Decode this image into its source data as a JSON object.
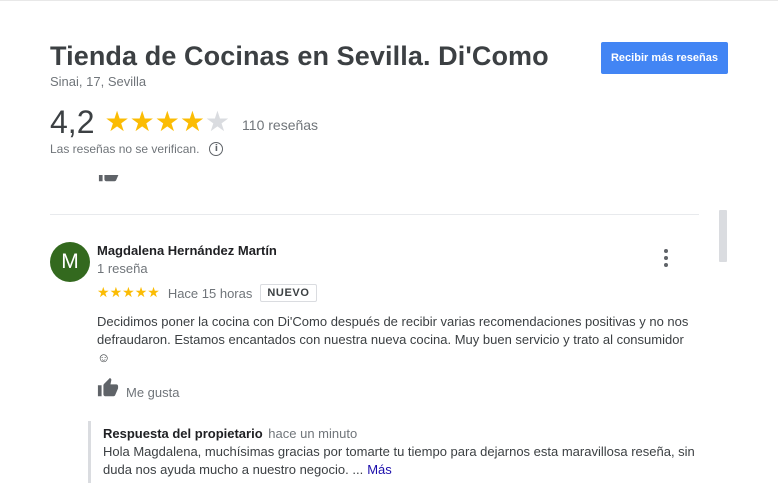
{
  "business": {
    "title": "Tienda de Cocinas en Sevilla. Di'Como",
    "address": "Sinai, 17, Sevilla"
  },
  "actions": {
    "more_reviews_label": "Recibir más reseñas"
  },
  "rating": {
    "value": "4,2",
    "stars_filled": 4,
    "stars_total": 5,
    "count_label": "110 reseñas",
    "disclaimer": "Las reseñas no se verifican.",
    "info_glyph": "i"
  },
  "review": {
    "avatar_letter": "M",
    "avatar_color": "#33691e",
    "author": "Magdalena Hernández Martín",
    "author_meta": "1 reseña",
    "stars": 5,
    "time": "Hace 15 horas",
    "badge": "NUEVO",
    "text": "Decidimos poner la cocina con Di'Como después de recibir varias recomendaciones positivas y no nos defraudaron. Estamos encantados con nuestra nueva cocina. Muy buen servicio y trato al consumidor ☺",
    "like_label": "Me gusta",
    "owner_reply": {
      "title": "Respuesta del propietario",
      "time": "hace un minuto",
      "text": "Hola Magdalena, muchísimas gracias por tomarte tu tiempo para dejarnos esta maravillosa reseña, sin duda nos ayuda mucho a nuestro negocio. ...",
      "more_label": "Más"
    }
  },
  "colors": {
    "accent": "#4285f4",
    "star": "#fbbc04",
    "star_empty": "#dadce0"
  }
}
